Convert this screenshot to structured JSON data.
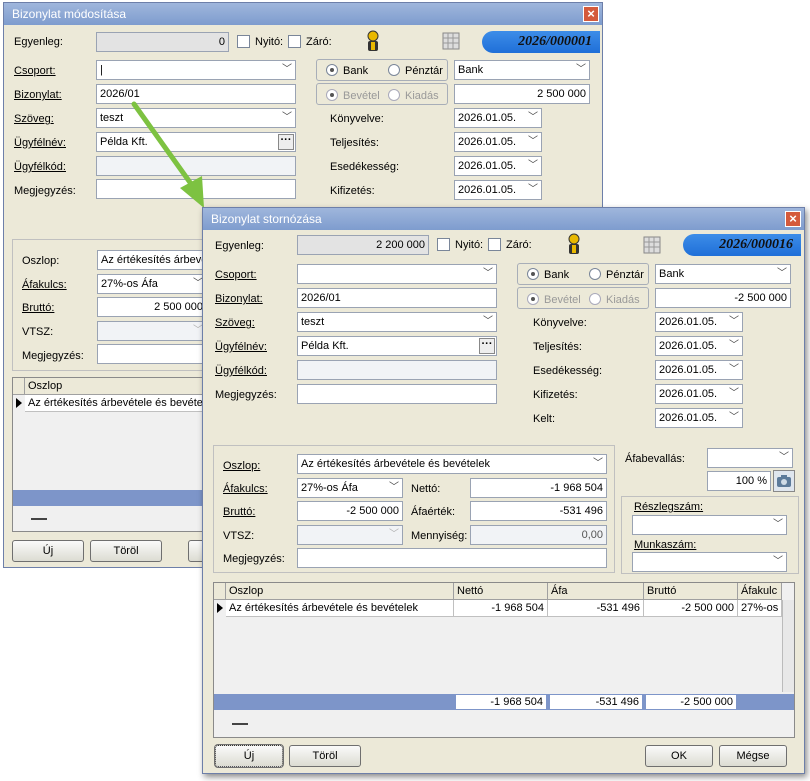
{
  "arrow_color": "#7dc241",
  "w1": {
    "title": "Bizonylat módosítása",
    "egyenleg_label": "Egyenleg:",
    "egyenleg_value": "0",
    "nyito": "Nyitó:",
    "zaro": "Záró:",
    "doc_number": "2026/000001",
    "csoport_label": "Csoport:",
    "csoport_value": "|",
    "bizonylat_label": "Bizonylat:",
    "bizonylat_value": "2026/01",
    "szoveg_label": "Szöveg:",
    "szoveg_value": "teszt",
    "ugyfelnev_label": "Ügyfélnév:",
    "ugyfelnev_value": "Példa Kft.",
    "ugyfelkod_label": "Ügyfélkód:",
    "megjegyzes_label": "Megjegyzés:",
    "bank_radio": "Bank",
    "penztar_radio": "Pénztár",
    "bevetel_radio": "Bevétel",
    "kiadas_radio": "Kiadás",
    "account": "Bank",
    "amount": "2 500 000",
    "konyvelve_label": "Könyvelve:",
    "konyvelve": "2026.01.05.",
    "teljesites_label": "Teljesítés:",
    "teljesites": "2026.01.05.",
    "esedekesseg_label": "Esedékesség:",
    "esedekesseg": "2026.01.05.",
    "kifizetes_label": "Kifizetés:",
    "kifizetes": "2026.01.05.",
    "oszlop_label": "Oszlop:",
    "oszlop_value": "Az értékesítés árbevé",
    "afakulcs_label": "Áfakulcs:",
    "afakulcs_value": "27%-os Áfa",
    "brutto_label": "Bruttó:",
    "brutto_value": "2 500 000",
    "vtsz_label": "VTSZ:",
    "megj2_label": "Megjegyzés:",
    "grid_col": "Oszlop",
    "grid_row": "Az értékesítés árbevétele és bevétel",
    "uj": "Új",
    "torol": "Töröl"
  },
  "w2": {
    "title": "Bizonylat stornózása",
    "egyenleg_label": "Egyenleg:",
    "egyenleg_value": "2 200 000",
    "nyito": "Nyitó:",
    "zaro": "Záró:",
    "doc_number": "2026/000016",
    "csoport_label": "Csoport:",
    "bizonylat_label": "Bizonylat:",
    "bizonylat_value": "2026/01",
    "szoveg_label": "Szöveg:",
    "szoveg_value": "teszt",
    "ugyfelnev_label": "Ügyfélnév:",
    "ugyfelnev_value": "Példa Kft.",
    "ugyfelkod_label": "Ügyfélkód:",
    "megjegyzes_label": "Megjegyzés:",
    "bank_radio": "Bank",
    "penztar_radio": "Pénztár",
    "bevetel_radio": "Bevétel",
    "kiadas_radio": "Kiadás",
    "account": "Bank",
    "amount": "-2 500 000",
    "konyvelve_label": "Könyvelve:",
    "konyvelve": "2026.01.05.",
    "teljesites_label": "Teljesítés:",
    "teljesites": "2026.01.05.",
    "esedekesseg_label": "Esedékesség:",
    "esedekesseg": "2026.01.05.",
    "kifizetes_label": "Kifizetés:",
    "kifizetes": "2026.01.05.",
    "kelt_label": "Kelt:",
    "kelt": "2026.01.05.",
    "oszlop_label": "Oszlop:",
    "oszlop_value": "Az értékesítés árbevétele és bevételek",
    "afakulcs_label": "Áfakulcs:",
    "afakulcs_value": "27%-os Áfa",
    "netto_label": "Nettó:",
    "netto_value": "-1 968 504",
    "brutto_label": "Bruttó:",
    "brutto_value": "-2 500 000",
    "afaertek_label": "Áfaérték:",
    "afaertek_value": "-531 496",
    "vtsz_label": "VTSZ:",
    "mennyiseg_label": "Mennyiség:",
    "mennyiseg_value": "0,00",
    "megj2_label": "Megjegyzés:",
    "afabevallas_label": "Áfabevallás:",
    "percent": "100 %",
    "reszlegszam_label": "Részlegszám:",
    "munkaszam_label": "Munkaszám:",
    "grid": {
      "headers": [
        "Oszlop",
        "Nettó",
        "Áfa",
        "Bruttó",
        "Áfakulc"
      ],
      "row": [
        "Az értékesítés árbevétele és bevételek",
        "-1 968 504",
        "-531 496",
        "-2 500 000",
        "27%-os"
      ],
      "totals": [
        "-1 968 504",
        "-531 496",
        "-2 500 000"
      ]
    },
    "uj": "Új",
    "torol": "Töröl",
    "ok": "OK",
    "megse": "Mégse"
  }
}
